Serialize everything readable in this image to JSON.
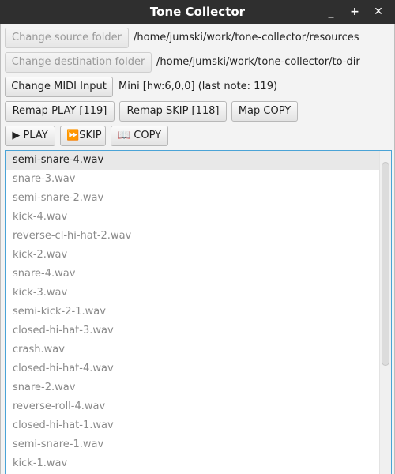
{
  "window": {
    "title": "Tone Collector",
    "minimize_icon": "minimize-icon",
    "maximize_icon": "maximize-icon",
    "close_icon": "close-icon",
    "minimize_glyph": "_",
    "maximize_glyph": "+",
    "close_glyph": "✕"
  },
  "source": {
    "button_label": "Change source folder",
    "path": "/home/jumski/work/tone-collector/resources"
  },
  "destination": {
    "button_label": "Change destination folder",
    "path": "/home/jumski/work/tone-collector/to-dir"
  },
  "midi": {
    "button_label": "Change MIDI Input",
    "status": "Mini [hw:6,0,0] (last note: 119)"
  },
  "remap": {
    "play_label": "Remap PLAY [119]",
    "skip_label": "Remap SKIP [118]",
    "copy_label": "Map COPY"
  },
  "actions": {
    "play_label": "▶ PLAY",
    "skip_label": "⏩SKIP",
    "copy_label": "📖 COPY"
  },
  "files": {
    "items": [
      "semi-snare-4.wav",
      "snare-3.wav",
      "semi-snare-2.wav",
      "kick-4.wav",
      "reverse-cl-hi-hat-2.wav",
      "kick-2.wav",
      "snare-4.wav",
      "kick-3.wav",
      "semi-kick-2-1.wav",
      "closed-hi-hat-3.wav",
      "crash.wav",
      "closed-hi-hat-4.wav",
      "snare-2.wav",
      "reverse-roll-4.wav",
      "closed-hi-hat-1.wav",
      "semi-snare-1.wav",
      "kick-1.wav"
    ],
    "selected_index": 0
  },
  "colors": {
    "titlebar": "#2f2f2f",
    "list_border": "#4aa3d6",
    "selected_row": "#e8e8e8"
  }
}
